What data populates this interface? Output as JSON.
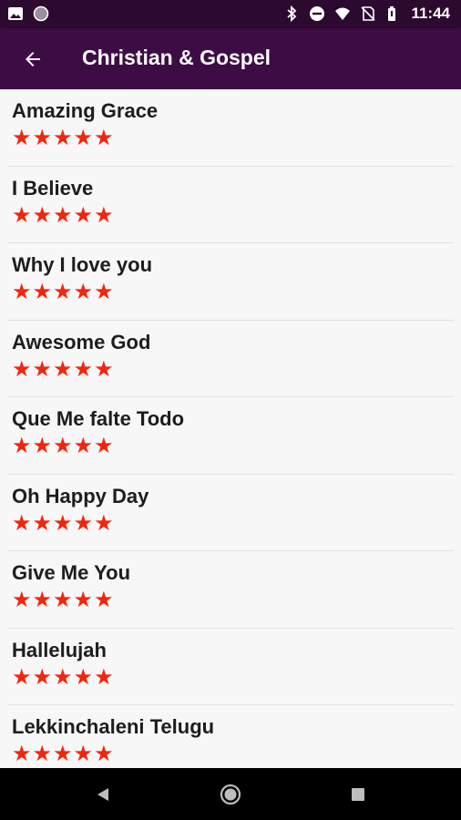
{
  "status_bar": {
    "time": "11:44",
    "left_icons": [
      "image-icon",
      "circle-notification-icon"
    ],
    "right_icons": [
      "bluetooth-icon",
      "do-not-disturb-icon",
      "wifi-icon",
      "no-sim-icon",
      "battery-icon"
    ]
  },
  "app_bar": {
    "title": "Christian & Gospel",
    "back_icon": "arrow-back-icon"
  },
  "songs": [
    {
      "title": "Amazing Grace",
      "rating": 5
    },
    {
      "title": "I Believe",
      "rating": 5
    },
    {
      "title": "Why I love you",
      "rating": 5
    },
    {
      "title": "Awesome God",
      "rating": 5
    },
    {
      "title": "Que Me falte Todo",
      "rating": 5
    },
    {
      "title": "Oh Happy Day",
      "rating": 5
    },
    {
      "title": "Give Me You",
      "rating": 5
    },
    {
      "title": "Hallelujah",
      "rating": 5
    },
    {
      "title": "Lekkinchaleni Telugu",
      "rating": 5
    }
  ],
  "colors": {
    "app_bar": "#3e0c44",
    "status_bar": "#2c0a2f",
    "star": "#f2260d",
    "background": "#f7f7f7"
  },
  "nav_bar": {
    "icons": [
      "back-triangle-icon",
      "home-circle-icon",
      "recents-square-icon"
    ]
  }
}
